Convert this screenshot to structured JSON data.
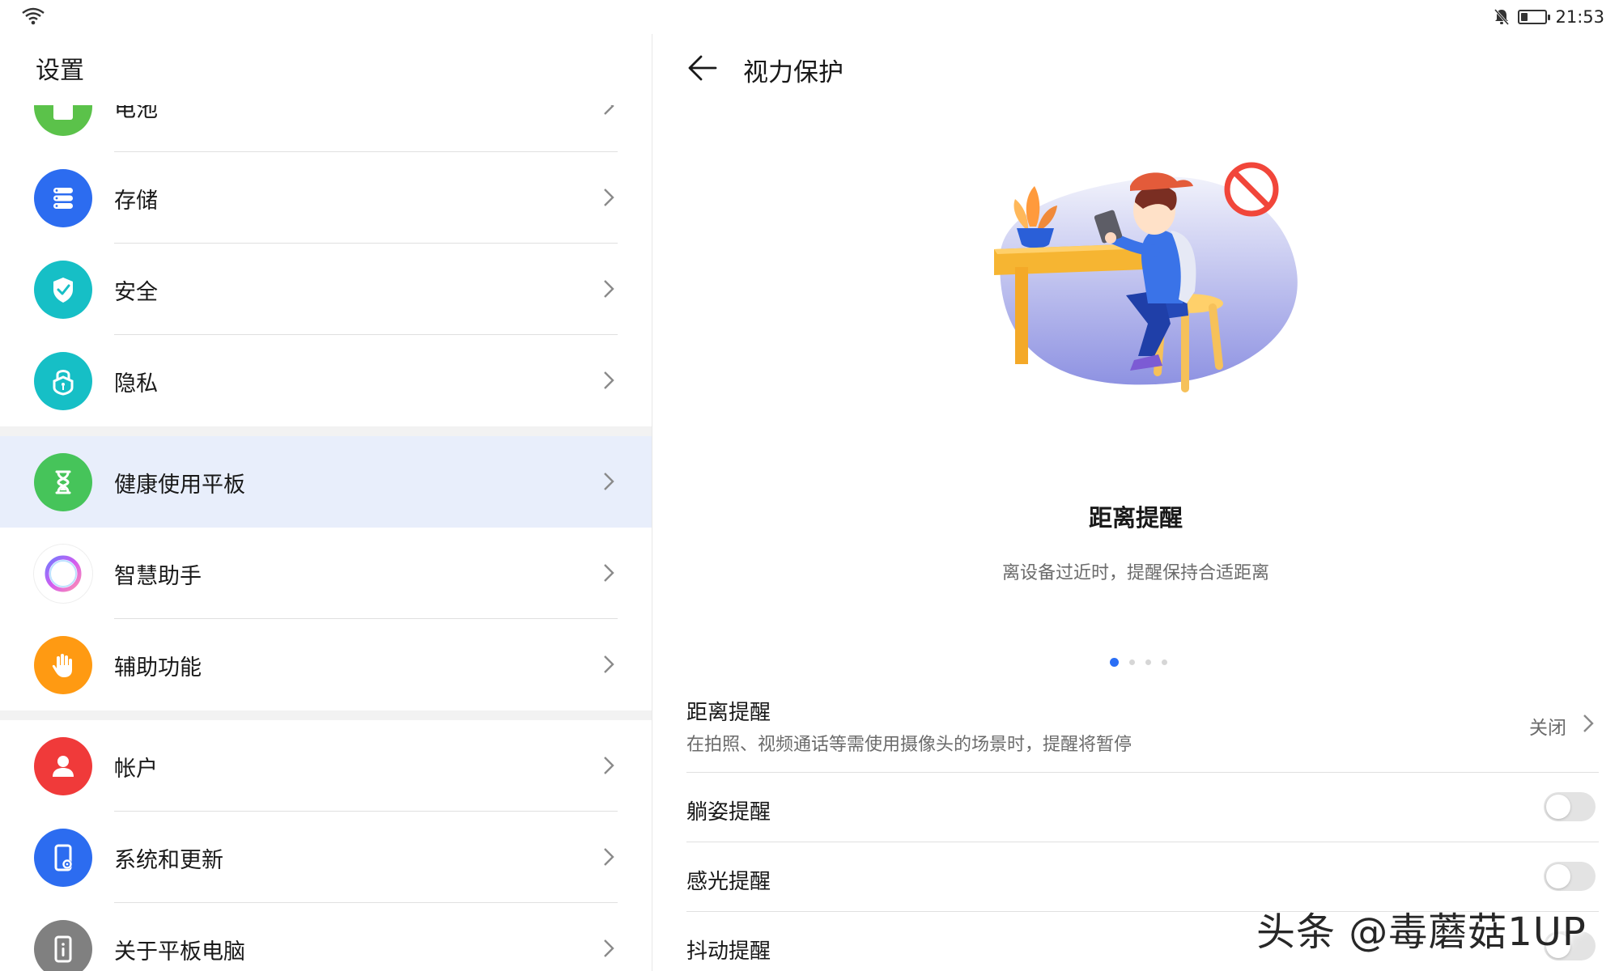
{
  "status": {
    "time": "21:53",
    "icons": [
      "wifi-icon",
      "mute-icon",
      "battery-icon"
    ],
    "battery_level": 0.3
  },
  "left": {
    "title": "设置",
    "group1": [
      {
        "label": "电池",
        "icon": "battery-icon",
        "color": "#5bc24a"
      },
      {
        "label": "存储",
        "icon": "storage-icon",
        "color": "#2c6cf0"
      },
      {
        "label": "安全",
        "icon": "shield-check-icon",
        "color": "#16bfc6"
      },
      {
        "label": "隐私",
        "icon": "privacy-lock-icon",
        "color": "#16bfc6"
      }
    ],
    "group2": [
      {
        "label": "健康使用平板",
        "icon": "hourglass-icon",
        "color": "#46c45a",
        "active": true
      },
      {
        "label": "智慧助手",
        "icon": "assistant-ring-icon",
        "color": "#ffffff"
      },
      {
        "label": "辅助功能",
        "icon": "hand-icon",
        "color": "#ff9a12"
      }
    ],
    "group3": [
      {
        "label": "帐户",
        "icon": "user-icon",
        "color": "#f03a3a"
      },
      {
        "label": "系统和更新",
        "icon": "system-update-icon",
        "color": "#2c6cf0"
      },
      {
        "label": "关于平板电脑",
        "icon": "about-tablet-icon",
        "color": "#808080"
      }
    ]
  },
  "right": {
    "title": "视力保护",
    "feature_title": "距离提醒",
    "feature_desc": "离设备过近时，提醒保持合适距离",
    "pager": {
      "count": 4,
      "active": 0
    },
    "settings": [
      {
        "name": "距离提醒",
        "sub": "在拍照、视频通话等需使用摄像头的场景时，提醒将暂停",
        "value": "关闭",
        "type": "link"
      },
      {
        "name": "躺姿提醒",
        "type": "toggle",
        "on": false
      },
      {
        "name": "感光提醒",
        "type": "toggle",
        "on": false
      },
      {
        "name": "抖动提醒",
        "type": "toggle",
        "on": false
      }
    ]
  },
  "watermark": "头条 @毒蘑菇1UP",
  "colors": {
    "accent": "#2a6ef5",
    "active_bg": "#e8eefb"
  }
}
